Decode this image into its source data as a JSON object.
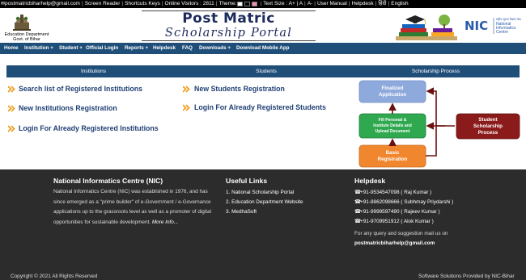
{
  "topbar": {
    "email": "postmatricbiharhelp@gmail.com",
    "screen_reader": "Screen Reader",
    "shortcut_keys": "Shortcuts Keys",
    "online_visitors": "Online Visitors : 2811",
    "theme_label": "Theme:",
    "theme_colors": [
      "#ffffff",
      "#000000",
      "#f48fb1"
    ],
    "text_size": "Text Size : A+ | A",
    "text_smaller": "A-",
    "user_manual": "User Manual",
    "helpdesk": "Helpdesk",
    "hindi": "हिंदी",
    "english": "English"
  },
  "header": {
    "dept_line1": "Education Department",
    "dept_line2": "Govt. of Bihar",
    "title": "Post Matric",
    "subtitle": "Scholarship Portal",
    "nic_hindi": "राष्ट्रीय सूचना विज्ञान केंद्र",
    "nic_short": "NIC",
    "nic_line1": "National",
    "nic_line2": "Informatics",
    "nic_line3": "Centre"
  },
  "nav": {
    "items": [
      "Home",
      "Institution",
      "Student",
      "Official Login",
      "Reports",
      "Helpdesk",
      "FAQ",
      "Downloads",
      "Download Mobile App"
    ],
    "dropdown_marker": "+"
  },
  "columns": {
    "institutions": "Institutions",
    "students": "Students",
    "process": "Scholarship Process"
  },
  "institution_links": [
    "Search list of Registered Institutions",
    "New Institutions Registration",
    "Login For Already Registered Institutions"
  ],
  "student_links": [
    "New Students Registration",
    "Login For Already Registered Students"
  ],
  "process": {
    "finalized_1": "Finalized",
    "finalized_2": "Application",
    "fill_1": "Fill Personal &",
    "fill_2": "Institute Details and",
    "fill_3": "Upload Document",
    "basic_1": "Basic",
    "basic_2": "Registration",
    "student_1": "Student",
    "student_2": "Scholarship",
    "student_3": "Process",
    "colors": {
      "finalized": "#8ea9db",
      "fill": "#2fa84f",
      "basic": "#f0862e",
      "student": "#8b1a1a",
      "arrow": "#6b1010"
    }
  },
  "footer": {
    "nic_heading": "National Informatics Centre (NIC)",
    "nic_text": "National Informatics Centre (NIC) was established in 1976, and has since emerged as a \"prime builder\" of e-Government / e-Governance applications up to the grassroots level as well as a promoter of digital opportunities for sustainable development.",
    "more_info": "More Info...",
    "useful_heading": "Useful Links",
    "useful_links": [
      "1. National Scholarship Portal",
      "2. Education Department Website",
      "3. MedhaSoft"
    ],
    "helpdesk_heading": "Helpdesk",
    "helpdesk_contacts": [
      "+91-9534547098 ( Raj Kumar )",
      "+91-8862098666 ( Subhmay Priydarshi )",
      "+91-9999597490 ( Rajeev Kumar )",
      "+91-9709951912 ( Alok Kumar )"
    ],
    "query_text": "For any query and suggestion mail us on",
    "query_email": "postmatricbiharhelp@gmail.com",
    "copyright": "Copyright © 2021 All Rights Reserved",
    "solutions": "Software Solutions Provided by NIC-Bihar"
  }
}
